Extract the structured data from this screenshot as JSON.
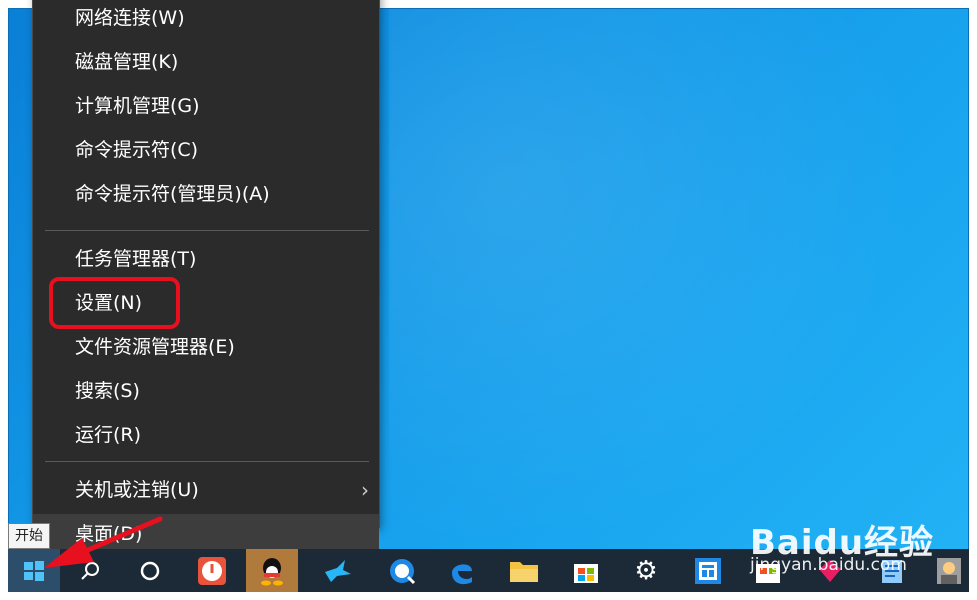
{
  "menu": {
    "items": [
      {
        "label": "网络连接(W)"
      },
      {
        "label": "磁盘管理(K)"
      },
      {
        "label": "计算机管理(G)"
      },
      {
        "label": "命令提示符(C)"
      },
      {
        "label": "命令提示符(管理员)(A)"
      },
      {
        "label": "任务管理器(T)"
      },
      {
        "label": "设置(N)"
      },
      {
        "label": "文件资源管理器(E)"
      },
      {
        "label": "搜索(S)"
      },
      {
        "label": "运行(R)"
      },
      {
        "label": "关机或注销(U)"
      },
      {
        "label": "桌面(D)"
      }
    ]
  },
  "start_tooltip": "开始",
  "watermark": {
    "logo": "Baidu经验",
    "sub": "jingyan.baidu.com"
  },
  "colors": {
    "highlight": "#e8101f",
    "arrow": "#e8101f",
    "menu_bg": "#2b2b2b",
    "taskbar_bg": "#1b2a36"
  },
  "taskbar": {
    "icons": [
      "windows-start-icon",
      "search-icon",
      "cortana-icon",
      "power-app-icon",
      "qq-icon",
      "bird-app-icon",
      "browser-app-icon",
      "edge-icon",
      "file-explorer-icon",
      "store-icon",
      "settings-gear-icon",
      "calculator-app-icon",
      "store-app-icon",
      "pink-app-icon",
      "notepad-app-icon",
      "user-app-icon"
    ]
  }
}
